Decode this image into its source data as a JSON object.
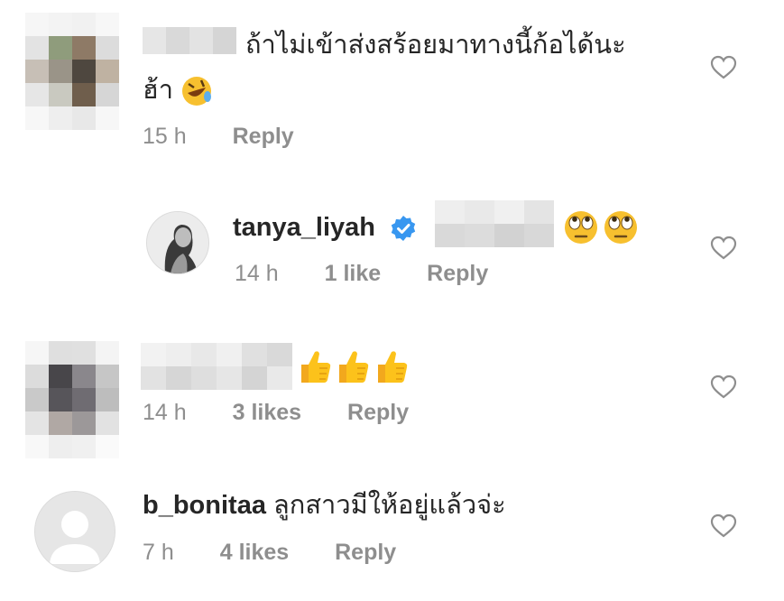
{
  "comments": [
    {
      "text_line1": "ถ้าไม่เข้าส่งสร้อยมาทางนี้ก้อได้นะ",
      "text_line2": "ฮ้า",
      "time": "15 h",
      "reply": "Reply",
      "emoji": "rolling-on-floor-laughing"
    },
    {
      "username": "tanya_liyah",
      "verified": true,
      "emoji": "face-with-rolling-eyes",
      "emoji_count": 2,
      "time": "14 h",
      "likes": "1 like",
      "reply": "Reply"
    },
    {
      "emoji": "thumbs-up",
      "emoji_count": 3,
      "time": "14 h",
      "likes": "3 likes",
      "reply": "Reply"
    },
    {
      "username": "b_bonitaa",
      "text": "ลูกสาวมีให้อยู่แล้วจ่ะ",
      "time": "7 h",
      "likes": "4 likes",
      "reply": "Reply"
    }
  ],
  "colors": {
    "text": "#262626",
    "meta": "#8e8e8e",
    "verified": "#3897f0",
    "heart_stroke": "#8e8e8e"
  }
}
